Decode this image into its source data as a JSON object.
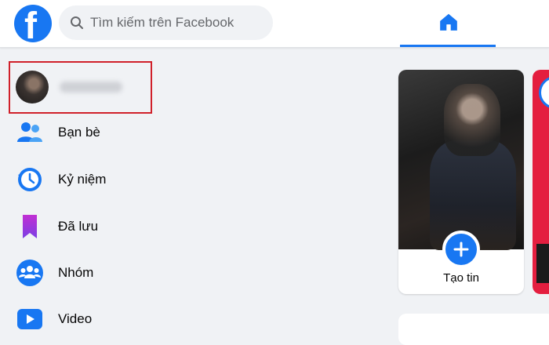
{
  "search": {
    "placeholder": "Tìm kiếm trên Facebook"
  },
  "logo": {
    "letter": "f"
  },
  "sidebar": {
    "items": [
      {
        "label": "Bạn bè",
        "icon": "friends-icon"
      },
      {
        "label": "Kỷ niệm",
        "icon": "memories-icon"
      },
      {
        "label": "Đã lưu",
        "icon": "saved-icon"
      },
      {
        "label": "Nhóm",
        "icon": "groups-icon"
      },
      {
        "label": "Video",
        "icon": "video-icon"
      }
    ]
  },
  "stories": {
    "create_label": "Tạo tin"
  },
  "colors": {
    "brand": "#1877f2",
    "highlight": "#d0202a"
  }
}
